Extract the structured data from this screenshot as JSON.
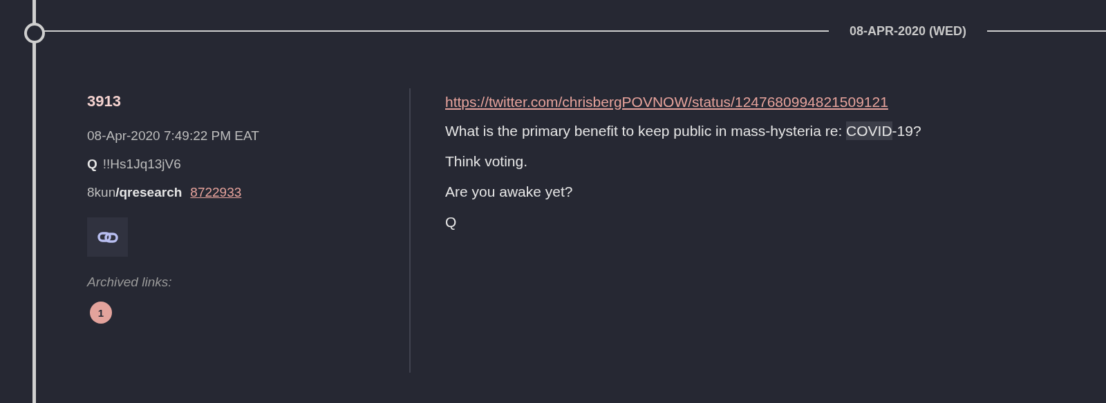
{
  "timeline": {
    "date": "08-APR-2020 (WED)"
  },
  "post": {
    "number": "3913",
    "timestamp": "08-Apr-2020 7:49:22 PM EAT",
    "author": "Q",
    "tripcode": "!!Hs1Jq13jV6",
    "site": "8kun",
    "board": "/qresearch",
    "post_link": "8722933",
    "archived_label": "Archived links:",
    "archived_links": [
      "1"
    ],
    "lines": [
      {
        "kind": "link",
        "segments": [
          {
            "text": "https://twitter.com/chrisbergPOVNOW/status/1247680994821509121",
            "highlight": false
          }
        ]
      },
      {
        "kind": "text",
        "segments": [
          {
            "text": "What is the primary benefit to keep public in mass-hysteria re: ",
            "highlight": false
          },
          {
            "text": "COVID",
            "highlight": true
          },
          {
            "text": "-19?",
            "highlight": false
          }
        ]
      },
      {
        "kind": "text",
        "segments": [
          {
            "text": "Think voting.",
            "highlight": false
          }
        ]
      },
      {
        "kind": "text",
        "segments": [
          {
            "text": "Are you awake yet?",
            "highlight": false
          }
        ]
      },
      {
        "kind": "text",
        "segments": [
          {
            "text": "Q",
            "highlight": false
          }
        ]
      }
    ]
  }
}
